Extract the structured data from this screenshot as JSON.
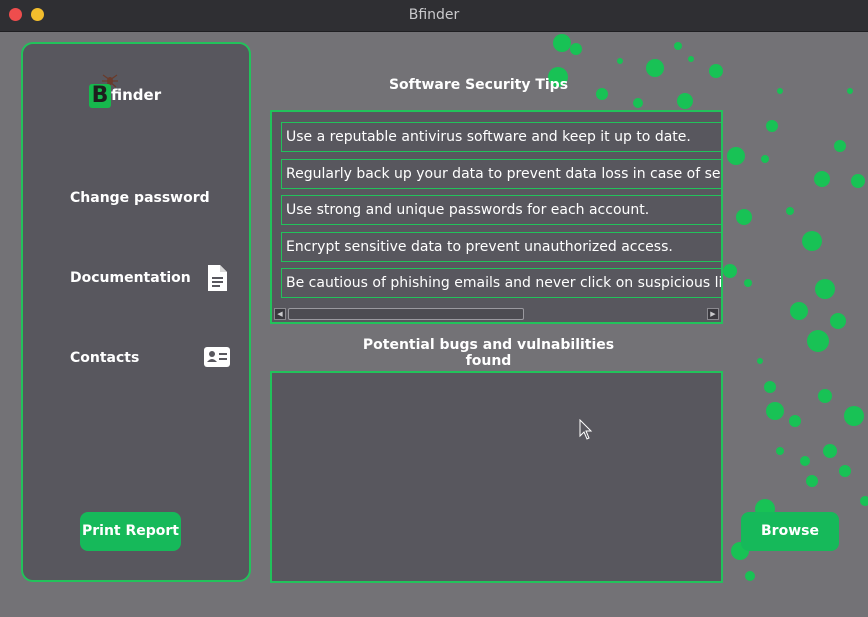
{
  "window": {
    "title": "Bfinder"
  },
  "sidebar": {
    "logo_b": "B",
    "logo_text": "finder",
    "items": [
      {
        "label": "Change password",
        "icon": "none"
      },
      {
        "label": "Documentation",
        "icon": "document-icon"
      },
      {
        "label": "Contacts",
        "icon": "contact-card-icon"
      }
    ],
    "print_report_label": "Print Report"
  },
  "tips": {
    "title": "Software Security Tips",
    "items": [
      "Use a reputable antivirus software and keep it up to date.",
      "Regularly back up your data to prevent data loss in case of security",
      "Use strong and unique passwords for each account.",
      "Encrypt sensitive data to prevent unauthorized access.",
      "Be cautious of phishing emails and never click on suspicious links o"
    ]
  },
  "bugs": {
    "title": "Potential bugs and vulnabilities found"
  },
  "browse_label": "Browse",
  "colors": {
    "accent": "#22c25b",
    "button": "#16b95a",
    "panel": "#58575e",
    "background": "#737276"
  }
}
